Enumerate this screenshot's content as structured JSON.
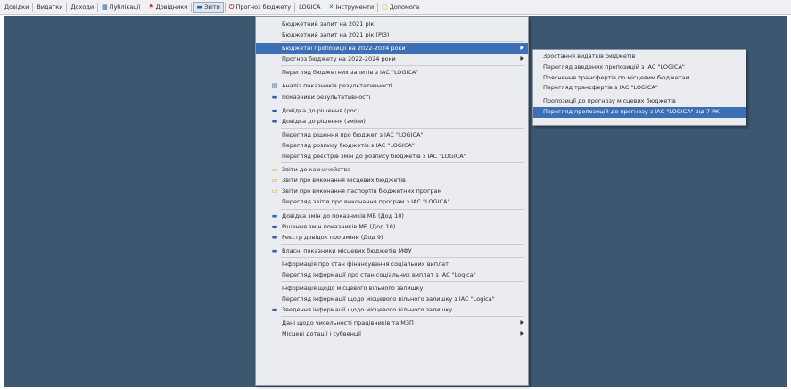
{
  "colors": {
    "desktop": "#3b5870",
    "menubar": "#eef0f3",
    "menu_bg": "#eaecef",
    "highlight": "#3d6fb4"
  },
  "menubar": [
    {
      "label": "Довідки",
      "icon": ""
    },
    {
      "label": "Видатки",
      "icon": ""
    },
    {
      "label": "Доходи",
      "icon": ""
    },
    {
      "label": "Публікації",
      "icon": "calendar-icon"
    },
    {
      "label": "Довідники",
      "icon": "flag-icon"
    },
    {
      "label": "Звіти",
      "icon": "dash-icon",
      "active": true
    },
    {
      "label": "Прогноз бюджету",
      "icon": "power-icon"
    },
    {
      "label": "LOGICA",
      "icon": ""
    },
    {
      "label": "Інструменти",
      "icon": "tools-icon"
    },
    {
      "label": "Допомога",
      "icon": "help-icon"
    }
  ],
  "dropdown": [
    {
      "label": "Бюджетний запит на 2021 рік",
      "icon": "",
      "arrow": false
    },
    {
      "label": "Бюджетний запит на 2021 рік (PIЗ)",
      "icon": "",
      "arrow": false
    },
    {
      "sep": true
    },
    {
      "label": "Бюджетні пропозиції на 2022-2024 роки",
      "icon": "",
      "arrow": true,
      "highlight": true
    },
    {
      "label": "Прогноз бюджету на 2022-2024 роки",
      "icon": "",
      "arrow": true
    },
    {
      "sep": true
    },
    {
      "label": "Перегляд бюджетних запитів з ІАС \"LOGICA\"",
      "icon": "",
      "arrow": false
    },
    {
      "sep": true
    },
    {
      "label": "Аналіз показників результативності",
      "icon": "table-icon",
      "arrow": false
    },
    {
      "label": "Показники результативності",
      "icon": "dash-icon",
      "arrow": false
    },
    {
      "sep": true
    },
    {
      "label": "Довідка до рішення (рос)",
      "icon": "dash-icon",
      "arrow": false
    },
    {
      "label": "Довідка до рішення (зміни)",
      "icon": "dash-icon",
      "arrow": false
    },
    {
      "sep": true
    },
    {
      "label": "Перегляд рішення про бюджет з ІАС \"LOGICA\"",
      "icon": "",
      "arrow": false
    },
    {
      "label": "Перегляд розпису бюджетів з ІАС \"LOGICA\"",
      "icon": "",
      "arrow": false
    },
    {
      "label": "Перегляд реєстрів змін до розпису бюджетів з ІАС \"LOGICA\"",
      "icon": "",
      "arrow": false
    },
    {
      "sep": true
    },
    {
      "label": "Звіти до казначейства",
      "icon": "folder-icon",
      "arrow": false
    },
    {
      "label": "Звіти про виконання місцевих бюджетів",
      "icon": "folder-icon",
      "arrow": false
    },
    {
      "label": "Звіти про виконання паспортів бюджетних програм",
      "icon": "folder-icon",
      "arrow": false
    },
    {
      "label": "Перегляд звітів про виконання програм з ІАС \"LOGICA\"",
      "icon": "",
      "arrow": false
    },
    {
      "sep": true
    },
    {
      "label": "Довідка змін до показників МБ (Дод 10)",
      "icon": "dash-icon",
      "arrow": false
    },
    {
      "label": "Рішення змін показників МБ (Дод 10)",
      "icon": "dash-icon",
      "arrow": false
    },
    {
      "label": "Реєстр довідок про зміни (Дод 9)",
      "icon": "dash-icon",
      "arrow": false
    },
    {
      "sep": true
    },
    {
      "label": "Власні показники місцевих бюджетів МФУ",
      "icon": "dash-icon",
      "arrow": false
    },
    {
      "sep": true
    },
    {
      "label": "Інформація про стан фінансування соціальних виплат",
      "icon": "",
      "arrow": false
    },
    {
      "label": "Перегляд інформації про стан соціальних виплат з ІАС \"Logica\"",
      "icon": "",
      "arrow": false
    },
    {
      "sep": true
    },
    {
      "label": "Інформація щодо місцевого вільного залишку",
      "icon": "",
      "arrow": false
    },
    {
      "label": "Перегляд інформації щодо місцевого вільного залишку з ІАС \"Logica\"",
      "icon": "",
      "arrow": false
    },
    {
      "label": "Зведення інформації щодо місцевого вільного залишку",
      "icon": "dash-icon",
      "arrow": false
    },
    {
      "sep": true
    },
    {
      "label": "Дані щодо чисельності працівників та МЗП",
      "icon": "",
      "arrow": true
    },
    {
      "label": "Місцеві дотації і субвенції",
      "icon": "",
      "arrow": true
    }
  ],
  "submenu": [
    {
      "label": "Зростання видатків бюджетів",
      "highlight": false
    },
    {
      "label": "Перегляд зведених пропозицій з ІАС \"LOGICA\"",
      "highlight": false
    },
    {
      "label": "Пояснення трансфертів по місцевим бюджетам",
      "highlight": false
    },
    {
      "label": "Перегляд трансфертів з ІАС \"LOGICA\"",
      "highlight": false
    },
    {
      "sep": true
    },
    {
      "label": "Пропозиції до прогнозу місцевих бюджетів",
      "highlight": false
    },
    {
      "label": "Перегляд пропозицій до прогнозу з ІАС \"LOGICA\" від 7 РК",
      "highlight": true
    }
  ]
}
